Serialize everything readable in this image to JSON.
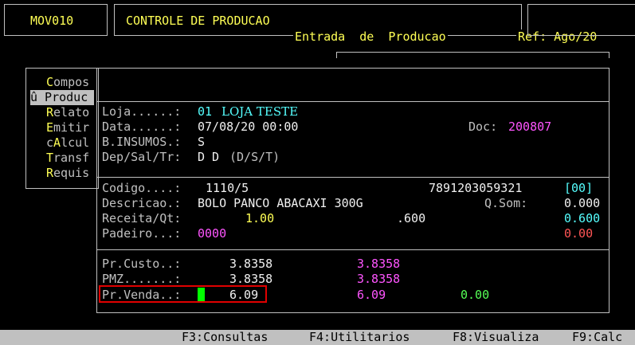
{
  "header": {
    "program_code": "MOV010",
    "module_title": "CONTROLE DE PRODUCAO",
    "screen_title": "Entrada  de  Producao",
    "reference": "Ref: Ago/20"
  },
  "menu": {
    "items": [
      {
        "hotkey": "C",
        "rest": "ompos"
      },
      {
        "hotkey": "û",
        "rest": " Produc"
      },
      {
        "hotkey": "R",
        "rest": "elato"
      },
      {
        "hotkey": "E",
        "rest": "mitir"
      },
      {
        "hotkey": "c",
        "hot2": "A",
        "rest": "lcul"
      },
      {
        "hotkey": "T",
        "rest": "ransf"
      },
      {
        "hotkey": "R",
        "rest": "equis"
      }
    ]
  },
  "form": {
    "loja_label": "Loja......:",
    "loja_code": "01",
    "loja_name": "LOJA TESTE",
    "data_label": "Data......:",
    "data_value": "07/08/20 00:00",
    "doc_label": "Doc:",
    "doc_value": "200807",
    "insumos_label": "B.INSUMOS.:",
    "insumos_value": "S",
    "dep_label": "Dep/Sal/Tr:",
    "dep_value": "D D",
    "dep_hint": "(D/S/T)"
  },
  "product": {
    "codigo_label": "Codigo....:",
    "codigo_value": "1110/5",
    "barcode": "7891203059321",
    "bracket_value": "[00]",
    "descricao_label": "Descricao.:",
    "descricao_value": "BOLO PANCO ABACAXI 300G",
    "qsom_label": "Q.Som:",
    "qsom_value": "0.000",
    "receita_label": "Receita/Qt:",
    "receita_value": "1.00",
    "receita_qty": ".600",
    "receita_right": "0.600",
    "padeiro_label": "Padeiro...:",
    "padeiro_value": "0000",
    "padeiro_right": "0.00"
  },
  "prices": {
    "custo_label": "Pr.Custo..:",
    "custo_value": "3.8358",
    "custo_alt": "3.8358",
    "pmz_label": "PMZ.......:",
    "pmz_value": "3.8358",
    "pmz_alt": "3.8358",
    "venda_label": "Pr.Venda..:",
    "venda_value": "6.09",
    "venda_alt": "6.09",
    "venda_extra": "0.00"
  },
  "footer": {
    "f3": "F3:Consultas",
    "f4": "F4:Utilitarios",
    "f8": "F8:Visualiza",
    "f9": "F9:Calc"
  },
  "colors": {
    "highlight_box": "#e00000",
    "cursor": "#00ff00"
  }
}
